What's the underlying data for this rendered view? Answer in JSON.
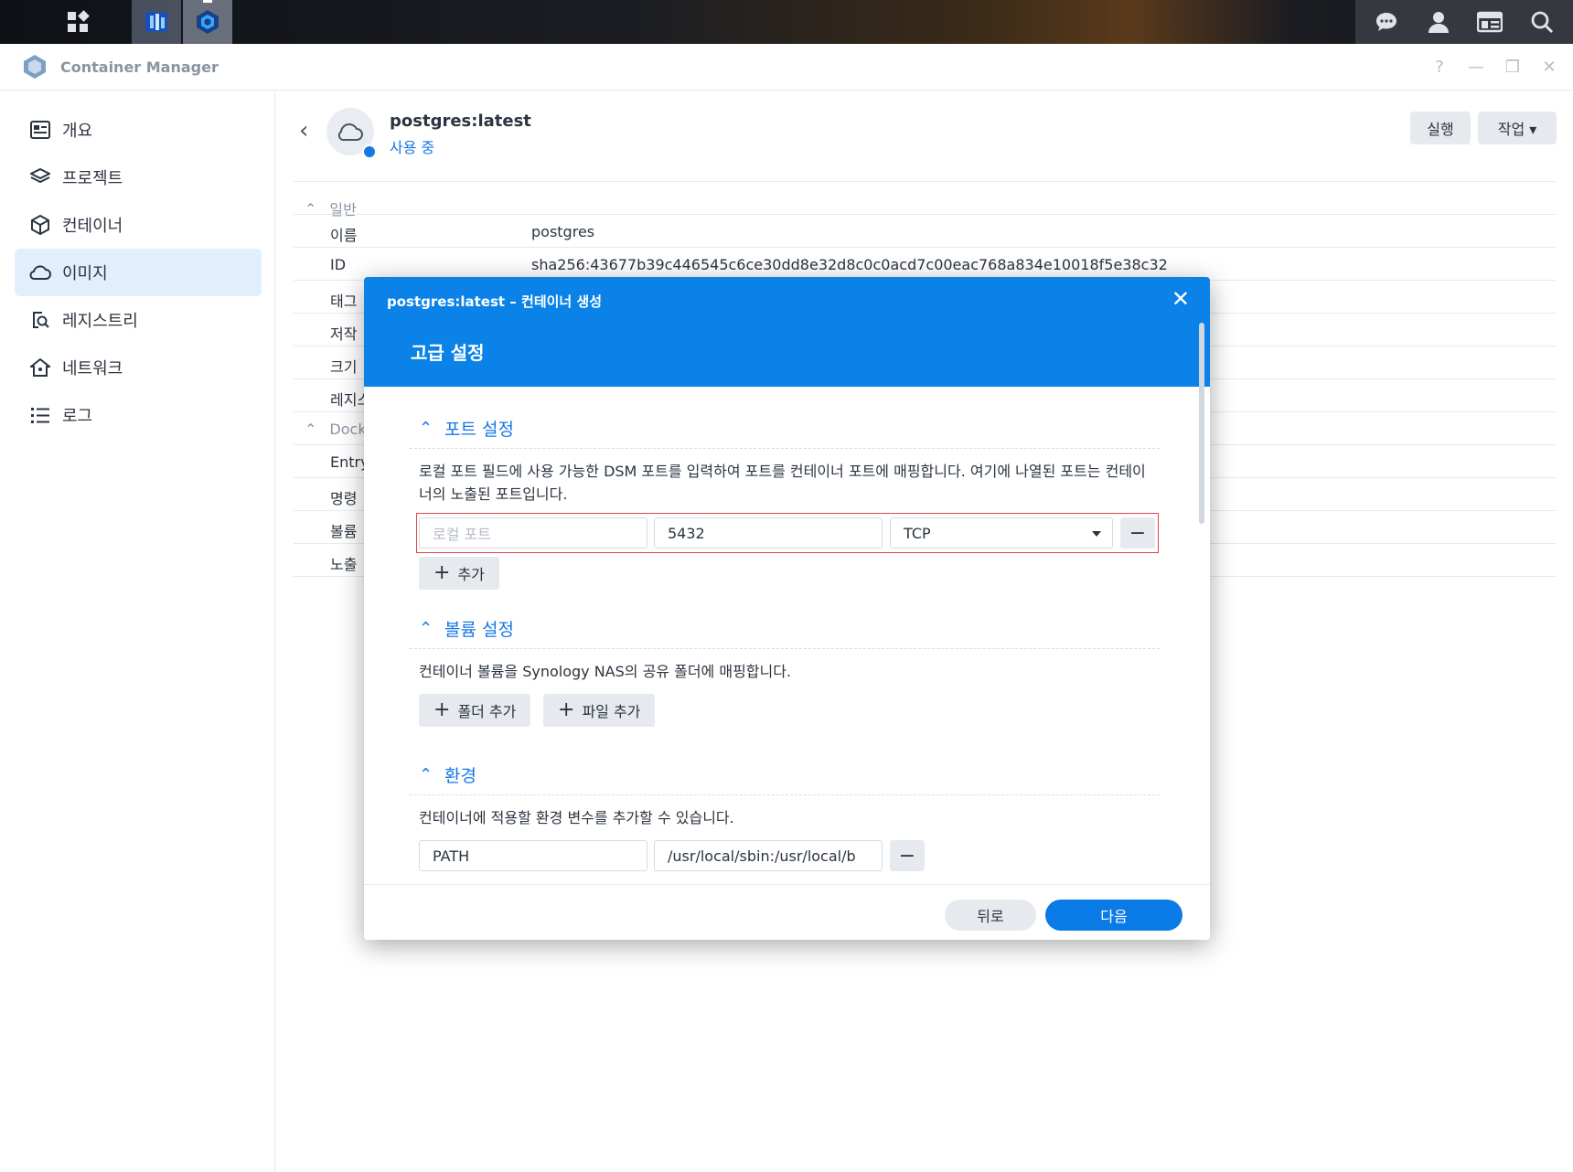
{
  "window": {
    "title": "Container Manager",
    "controls": [
      "?",
      "—",
      "❐",
      "✕"
    ]
  },
  "sidebar": {
    "items": [
      {
        "label": "개요",
        "icon": "overview-icon"
      },
      {
        "label": "프로젝트",
        "icon": "layers-icon"
      },
      {
        "label": "컨테이너",
        "icon": "cube-icon"
      },
      {
        "label": "이미지",
        "icon": "cloud-icon",
        "active": true
      },
      {
        "label": "레지스트리",
        "icon": "registry-search-icon"
      },
      {
        "label": "네트워크",
        "icon": "network-home-icon"
      },
      {
        "label": "로그",
        "icon": "list-icon"
      }
    ]
  },
  "image": {
    "name": "postgres:latest",
    "status": "사용 중",
    "run_label": "실행",
    "action_label": "작업 ▾"
  },
  "details": {
    "general_header": "일반",
    "rows": [
      {
        "label": "이름",
        "value": "postgres"
      },
      {
        "label": "ID",
        "value": "sha256:43677b39c446545c6ce30dd8e32d8c0c0acd7c00eac768a834e10018f5e38c32"
      },
      {
        "label": "태그",
        "value": ""
      },
      {
        "label": "저작",
        "value": ""
      },
      {
        "label": "크기",
        "value": ""
      },
      {
        "label": "레지스",
        "value": ""
      }
    ],
    "docker_header": "Dock",
    "docker_rows": [
      {
        "label": "Entry"
      },
      {
        "label": "명령"
      },
      {
        "label": "볼륨"
      },
      {
        "label": "노출"
      }
    ]
  },
  "modal": {
    "title": "postgres:latest – 컨테이너 생성",
    "subtitle": "고급 설정",
    "close_icon": "✕",
    "port": {
      "header": "포트 설정",
      "description": "로컬 포트 필드에 사용 가능한 DSM 포트를 입력하여 포트를 컨테이너 포트에 매핑합니다. 여기에 나열된 포트는 컨테이너의 노출된 포트입니다.",
      "local_port_placeholder": "로컬 포트",
      "container_port": "5432",
      "protocol": "TCP",
      "add_label": "추가"
    },
    "volume": {
      "header": "볼륨 설정",
      "description": "컨테이너 볼륨을 Synology NAS의 공유 폴더에 매핑합니다.",
      "add_folder_label": "폴더 추가",
      "add_file_label": "파일 추가"
    },
    "env": {
      "header": "환경",
      "description": "컨테이너에 적용할 환경 변수를 추가할 수 있습니다.",
      "var_name": "PATH",
      "var_value": "/usr/local/sbin:/usr/local/b"
    },
    "footer": {
      "back_label": "뒤로",
      "next_label": "다음"
    }
  },
  "colors": {
    "accent": "#0a82e8",
    "highlight": "#e5404a",
    "active_nav": "#e1eefb"
  }
}
